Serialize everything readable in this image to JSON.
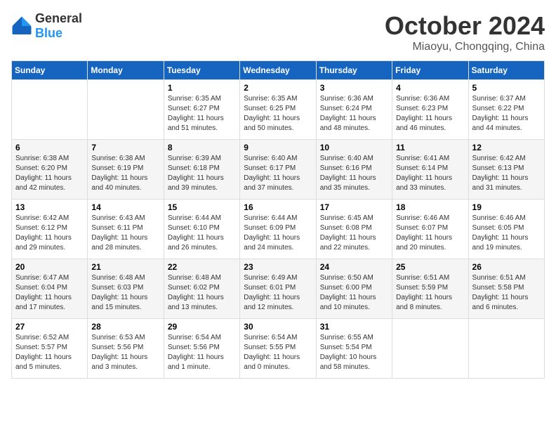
{
  "header": {
    "logo": {
      "general": "General",
      "blue": "Blue"
    },
    "title": "October 2024",
    "location": "Miaoyu, Chongqing, China"
  },
  "calendar": {
    "days_of_week": [
      "Sunday",
      "Monday",
      "Tuesday",
      "Wednesday",
      "Thursday",
      "Friday",
      "Saturday"
    ],
    "weeks": [
      [
        {
          "day": "",
          "sunrise": "",
          "sunset": "",
          "daylight": ""
        },
        {
          "day": "",
          "sunrise": "",
          "sunset": "",
          "daylight": ""
        },
        {
          "day": "1",
          "sunrise": "Sunrise: 6:35 AM",
          "sunset": "Sunset: 6:27 PM",
          "daylight": "Daylight: 11 hours and 51 minutes."
        },
        {
          "day": "2",
          "sunrise": "Sunrise: 6:35 AM",
          "sunset": "Sunset: 6:25 PM",
          "daylight": "Daylight: 11 hours and 50 minutes."
        },
        {
          "day": "3",
          "sunrise": "Sunrise: 6:36 AM",
          "sunset": "Sunset: 6:24 PM",
          "daylight": "Daylight: 11 hours and 48 minutes."
        },
        {
          "day": "4",
          "sunrise": "Sunrise: 6:36 AM",
          "sunset": "Sunset: 6:23 PM",
          "daylight": "Daylight: 11 hours and 46 minutes."
        },
        {
          "day": "5",
          "sunrise": "Sunrise: 6:37 AM",
          "sunset": "Sunset: 6:22 PM",
          "daylight": "Daylight: 11 hours and 44 minutes."
        }
      ],
      [
        {
          "day": "6",
          "sunrise": "Sunrise: 6:38 AM",
          "sunset": "Sunset: 6:20 PM",
          "daylight": "Daylight: 11 hours and 42 minutes."
        },
        {
          "day": "7",
          "sunrise": "Sunrise: 6:38 AM",
          "sunset": "Sunset: 6:19 PM",
          "daylight": "Daylight: 11 hours and 40 minutes."
        },
        {
          "day": "8",
          "sunrise": "Sunrise: 6:39 AM",
          "sunset": "Sunset: 6:18 PM",
          "daylight": "Daylight: 11 hours and 39 minutes."
        },
        {
          "day": "9",
          "sunrise": "Sunrise: 6:40 AM",
          "sunset": "Sunset: 6:17 PM",
          "daylight": "Daylight: 11 hours and 37 minutes."
        },
        {
          "day": "10",
          "sunrise": "Sunrise: 6:40 AM",
          "sunset": "Sunset: 6:16 PM",
          "daylight": "Daylight: 11 hours and 35 minutes."
        },
        {
          "day": "11",
          "sunrise": "Sunrise: 6:41 AM",
          "sunset": "Sunset: 6:14 PM",
          "daylight": "Daylight: 11 hours and 33 minutes."
        },
        {
          "day": "12",
          "sunrise": "Sunrise: 6:42 AM",
          "sunset": "Sunset: 6:13 PM",
          "daylight": "Daylight: 11 hours and 31 minutes."
        }
      ],
      [
        {
          "day": "13",
          "sunrise": "Sunrise: 6:42 AM",
          "sunset": "Sunset: 6:12 PM",
          "daylight": "Daylight: 11 hours and 29 minutes."
        },
        {
          "day": "14",
          "sunrise": "Sunrise: 6:43 AM",
          "sunset": "Sunset: 6:11 PM",
          "daylight": "Daylight: 11 hours and 28 minutes."
        },
        {
          "day": "15",
          "sunrise": "Sunrise: 6:44 AM",
          "sunset": "Sunset: 6:10 PM",
          "daylight": "Daylight: 11 hours and 26 minutes."
        },
        {
          "day": "16",
          "sunrise": "Sunrise: 6:44 AM",
          "sunset": "Sunset: 6:09 PM",
          "daylight": "Daylight: 11 hours and 24 minutes."
        },
        {
          "day": "17",
          "sunrise": "Sunrise: 6:45 AM",
          "sunset": "Sunset: 6:08 PM",
          "daylight": "Daylight: 11 hours and 22 minutes."
        },
        {
          "day": "18",
          "sunrise": "Sunrise: 6:46 AM",
          "sunset": "Sunset: 6:07 PM",
          "daylight": "Daylight: 11 hours and 20 minutes."
        },
        {
          "day": "19",
          "sunrise": "Sunrise: 6:46 AM",
          "sunset": "Sunset: 6:05 PM",
          "daylight": "Daylight: 11 hours and 19 minutes."
        }
      ],
      [
        {
          "day": "20",
          "sunrise": "Sunrise: 6:47 AM",
          "sunset": "Sunset: 6:04 PM",
          "daylight": "Daylight: 11 hours and 17 minutes."
        },
        {
          "day": "21",
          "sunrise": "Sunrise: 6:48 AM",
          "sunset": "Sunset: 6:03 PM",
          "daylight": "Daylight: 11 hours and 15 minutes."
        },
        {
          "day": "22",
          "sunrise": "Sunrise: 6:48 AM",
          "sunset": "Sunset: 6:02 PM",
          "daylight": "Daylight: 11 hours and 13 minutes."
        },
        {
          "day": "23",
          "sunrise": "Sunrise: 6:49 AM",
          "sunset": "Sunset: 6:01 PM",
          "daylight": "Daylight: 11 hours and 12 minutes."
        },
        {
          "day": "24",
          "sunrise": "Sunrise: 6:50 AM",
          "sunset": "Sunset: 6:00 PM",
          "daylight": "Daylight: 11 hours and 10 minutes."
        },
        {
          "day": "25",
          "sunrise": "Sunrise: 6:51 AM",
          "sunset": "Sunset: 5:59 PM",
          "daylight": "Daylight: 11 hours and 8 minutes."
        },
        {
          "day": "26",
          "sunrise": "Sunrise: 6:51 AM",
          "sunset": "Sunset: 5:58 PM",
          "daylight": "Daylight: 11 hours and 6 minutes."
        }
      ],
      [
        {
          "day": "27",
          "sunrise": "Sunrise: 6:52 AM",
          "sunset": "Sunset: 5:57 PM",
          "daylight": "Daylight: 11 hours and 5 minutes."
        },
        {
          "day": "28",
          "sunrise": "Sunrise: 6:53 AM",
          "sunset": "Sunset: 5:56 PM",
          "daylight": "Daylight: 11 hours and 3 minutes."
        },
        {
          "day": "29",
          "sunrise": "Sunrise: 6:54 AM",
          "sunset": "Sunset: 5:56 PM",
          "daylight": "Daylight: 11 hours and 1 minute."
        },
        {
          "day": "30",
          "sunrise": "Sunrise: 6:54 AM",
          "sunset": "Sunset: 5:55 PM",
          "daylight": "Daylight: 11 hours and 0 minutes."
        },
        {
          "day": "31",
          "sunrise": "Sunrise: 6:55 AM",
          "sunset": "Sunset: 5:54 PM",
          "daylight": "Daylight: 10 hours and 58 minutes."
        },
        {
          "day": "",
          "sunrise": "",
          "sunset": "",
          "daylight": ""
        },
        {
          "day": "",
          "sunrise": "",
          "sunset": "",
          "daylight": ""
        }
      ]
    ]
  }
}
